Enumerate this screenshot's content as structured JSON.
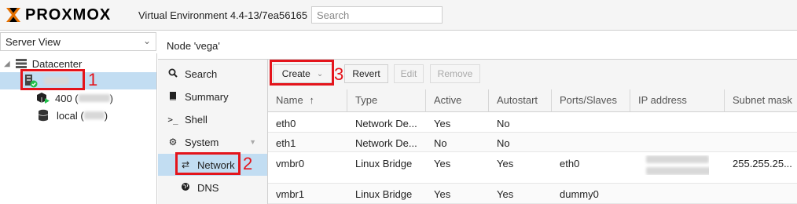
{
  "app": {
    "brand": "PROXMOX",
    "version": "Virtual Environment 4.4-13/7ea56165",
    "search_placeholder": "Search"
  },
  "sidebar": {
    "view_select": "Server View",
    "tree": [
      {
        "label": "Datacenter",
        "icon": "datacenter-icon"
      },
      {
        "label": "",
        "icon": "node-online-icon",
        "selected": true
      },
      {
        "label": "400 (",
        "suffix": ")",
        "icon": "vm-running-icon"
      },
      {
        "label": "local (",
        "suffix": ")",
        "icon": "storage-icon"
      }
    ]
  },
  "node": {
    "title": "Node 'vega'"
  },
  "nav": [
    {
      "label": "Search",
      "icon": "search-icon"
    },
    {
      "label": "Summary",
      "icon": "book-icon"
    },
    {
      "label": "Shell",
      "icon": "terminal-icon"
    },
    {
      "label": "System",
      "icon": "gears-icon"
    },
    {
      "label": "Network",
      "icon": "exchange-icon",
      "active": true
    },
    {
      "label": "DNS",
      "icon": "globe-icon"
    }
  ],
  "toolbar": {
    "create": "Create",
    "revert": "Revert",
    "edit": "Edit",
    "remove": "Remove"
  },
  "grid": {
    "columns": [
      "Name",
      "Type",
      "Active",
      "Autostart",
      "Ports/Slaves",
      "IP address",
      "Subnet mask"
    ],
    "rows": [
      [
        "eth0",
        "Network De...",
        "Yes",
        "No",
        "",
        "",
        ""
      ],
      [
        "eth1",
        "Network De...",
        "No",
        "No",
        "",
        "",
        ""
      ],
      [
        "vmbr0",
        "Linux Bridge",
        "Yes",
        "Yes",
        "eth0",
        "",
        "255.255.25..."
      ],
      [
        "vmbr1",
        "Linux Bridge",
        "Yes",
        "Yes",
        "dummy0",
        "",
        ""
      ]
    ]
  },
  "annotations": [
    "1",
    "2",
    "3"
  ],
  "colors": {
    "accent_orange": "#e57000",
    "selection": "#c2ddf2",
    "annotation_red": "#e4141b"
  }
}
